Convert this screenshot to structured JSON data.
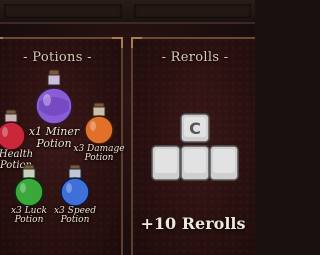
{
  "potions_panel": {
    "title": "- Potions -",
    "items": [
      {
        "label_line1": "x1 Miner",
        "label_line2": "Potion",
        "icon": "purple-potion-icon",
        "color": "#8a5cd6"
      },
      {
        "label_line1": "Health",
        "label_line2": "Potion",
        "icon": "red-potion-icon",
        "color": "#c8283a"
      },
      {
        "label_line1": "x3 Damage",
        "label_line2": "Potion",
        "icon": "orange-potion-icon",
        "color": "#e0702a"
      },
      {
        "label_line1": "x3 Luck",
        "label_line2": "Potion",
        "icon": "green-potion-icon",
        "color": "#3aa83a"
      },
      {
        "label_line1": "x3 Speed",
        "label_line2": "Potion",
        "icon": "blue-potion-icon",
        "color": "#3f6fd8"
      }
    ]
  },
  "rerolls_panel": {
    "title": "- Rerolls -",
    "icon": "reroll-keys-icon",
    "key_letter": "C",
    "amount": "+10 Rerolls"
  }
}
